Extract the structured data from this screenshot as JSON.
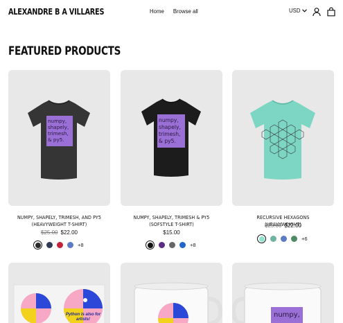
{
  "header": {
    "brand": "ALEXANDRE B A VILLARES",
    "nav": [
      {
        "label": "Home"
      },
      {
        "label": "Browse all"
      }
    ],
    "currency": "USD"
  },
  "section": {
    "title": "FEATURED PRODUCTS"
  },
  "products": [
    {
      "title": "NUMPY, SHAPELY, TRIMESH, AND PY5 (HEAVYWEIGHT T-SHIRT)",
      "old_price": "$25.00",
      "price": "$22.00",
      "design_text": "numpy, shapely, trimesh, & py5.",
      "swatches": [
        "#2a2a2a",
        "#2f3a56",
        "#c2233a",
        "#5b7bc4"
      ],
      "more": "+8"
    },
    {
      "title": "NUMPY, SHAPELY, TRIMESH & PY5 (SOFSTYLE T-SHIRT)",
      "old_price": "",
      "price": "$15.00",
      "design_text": "numpy, shapely, trimesh, & py5.",
      "swatches": [
        "#111111",
        "#5a2d82",
        "#666666",
        "#2266cc"
      ],
      "more": "+8"
    },
    {
      "title": "RECURSIVE HEXAGONS (HEAVYWEIGHT)",
      "old_price": "$25.00",
      "price": "$22.00",
      "design_text": "",
      "swatches": [
        "#8fe3cf",
        "#6fb3a0",
        "#5b7bc4",
        "#4f8a64"
      ],
      "more": "+6"
    }
  ],
  "row2": [
    {
      "sticker_text": "Python is also for artists!"
    },
    {
      "mug_text": ""
    },
    {
      "mug_text": "numpy,"
    }
  ],
  "colors": {
    "purple": "#9a6fd6",
    "shirt_dark": "#333333",
    "shirt_black": "#1a1a1a",
    "shirt_mint": "#7dd6c4"
  }
}
